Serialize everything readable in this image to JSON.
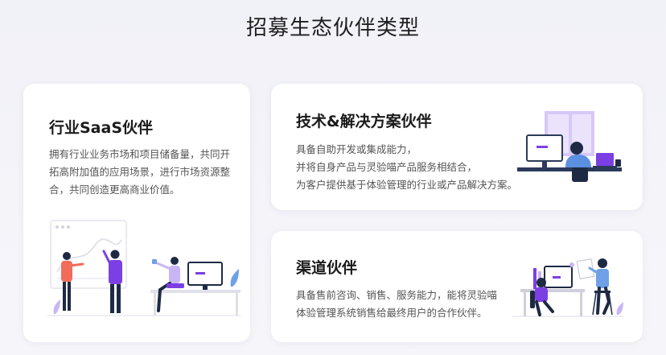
{
  "page": {
    "title": "招募生态伙伴类型"
  },
  "cards": {
    "saas": {
      "title": "行业SaaS伙伴",
      "description": "拥有行业业务市场和项目储备量，共同开拓高附加值的应用场景，进行市场资源整合，共同创造更高商业价值。",
      "illustration_icon": "team-collaboration-illustration"
    },
    "tech": {
      "title": "技术&解决方案伙伴",
      "description_lines": [
        "具备自助开发或集成能力，",
        "并将自身产品与灵验喵产品服务相结合，",
        "为客户提供基于体验管理的行业或产品解决方案。"
      ],
      "illustration_icon": "developer-at-desk-illustration"
    },
    "channel": {
      "title": "渠道伙伴",
      "description": "具备售前咨询、销售、服务能力，能将灵验喵体验管理系统销售给最终用户的合作伙伴。",
      "illustration_icon": "sales-meeting-illustration"
    }
  },
  "colors": {
    "accent_purple": "#7b3fe4",
    "light_purple": "#c8b5f5",
    "coral": "#f16c5b",
    "navy": "#1e2a44"
  }
}
